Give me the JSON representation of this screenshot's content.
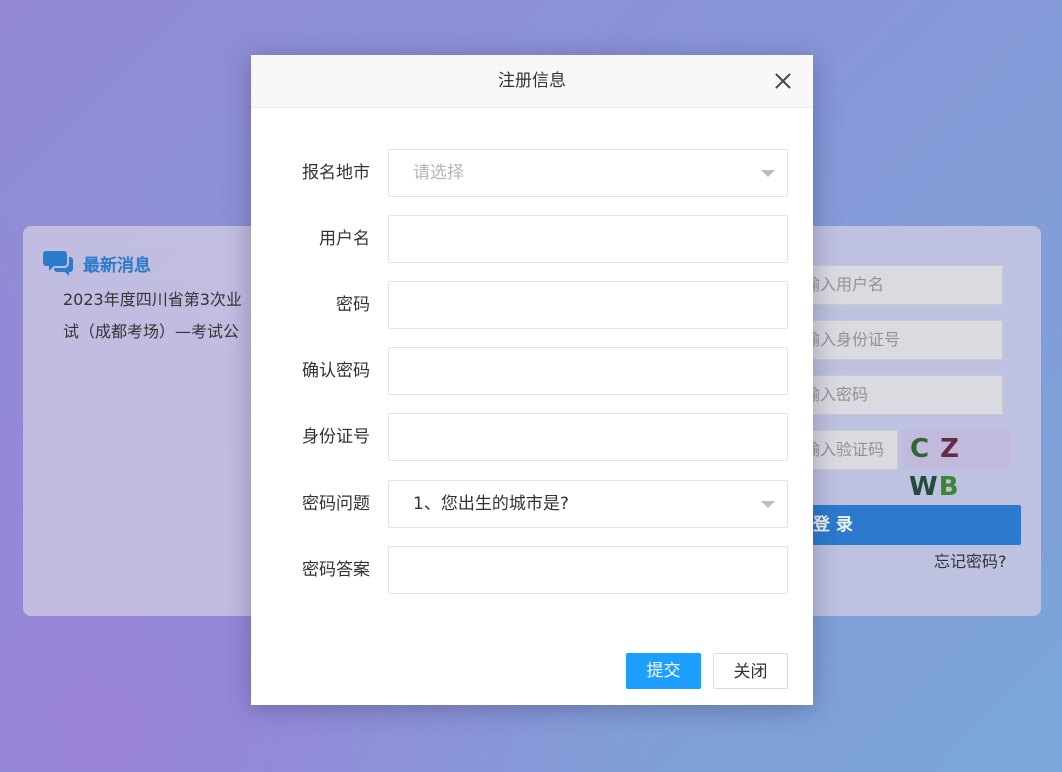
{
  "background": {
    "news": {
      "title": "最新消息",
      "line1": "2023年度四川省第3次业",
      "line2": "试（成都考场）—考试公"
    },
    "login": {
      "username_placeholder": "输入用户名",
      "idcard_placeholder": "输入身份证号",
      "password_placeholder": "输入密码",
      "captcha_placeholder": "输入验证码",
      "captcha_chars": [
        "C",
        "Z",
        "W",
        "B"
      ],
      "captcha_colors": [
        "#2f6b2f",
        "#6b2a4a",
        "#1f4d3a",
        "#3f8a2f"
      ],
      "login_label": "登 录",
      "forgot_label": "忘记密码?"
    }
  },
  "modal": {
    "title": "注册信息",
    "fields": [
      {
        "label": "报名地市",
        "type": "select",
        "value": "",
        "placeholder": "请选择"
      },
      {
        "label": "用户名",
        "type": "text",
        "value": "",
        "placeholder": ""
      },
      {
        "label": "密码",
        "type": "password",
        "value": "",
        "placeholder": ""
      },
      {
        "label": "确认密码",
        "type": "password",
        "value": "",
        "placeholder": ""
      },
      {
        "label": "身份证号",
        "type": "text",
        "value": "",
        "placeholder": ""
      },
      {
        "label": "密码问题",
        "type": "select",
        "value": "1、您出生的城市是?",
        "placeholder": ""
      },
      {
        "label": "密码答案",
        "type": "text",
        "value": "",
        "placeholder": ""
      }
    ],
    "submit_label": "提交",
    "close_label": "关闭"
  },
  "colors": {
    "accent": "#1e9fff",
    "login_button": "#2a7fd8",
    "news_title": "#2b7fd6"
  }
}
